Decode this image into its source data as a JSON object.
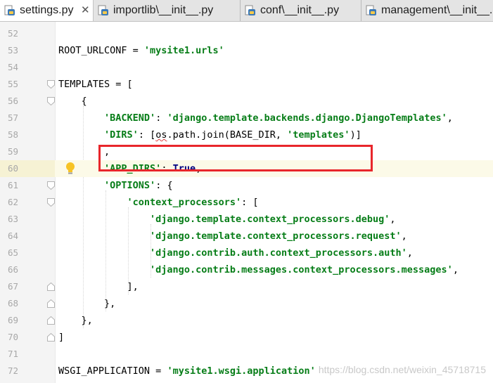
{
  "tabs": [
    {
      "label": "settings.py",
      "active": true,
      "close": "✕"
    },
    {
      "label": "importlib\\__init__.py",
      "active": false
    },
    {
      "label": "conf\\__init__.py",
      "active": false
    },
    {
      "label": "management\\__init__.py",
      "active": false
    }
  ],
  "lines": [
    {
      "no": "52",
      "code": ""
    },
    {
      "no": "53",
      "code": "ROOT_URLCONF = 'mysite1.urls'"
    },
    {
      "no": "54",
      "code": ""
    },
    {
      "no": "55",
      "code": "TEMPLATES = ["
    },
    {
      "no": "56",
      "code": "    {"
    },
    {
      "no": "57",
      "code": "        'BACKEND': 'django.template.backends.django.DjangoTemplates',"
    },
    {
      "no": "58",
      "code": "        'DIRS': [os.path.join(BASE_DIR, 'templates')]"
    },
    {
      "no": "59",
      "code": "        ,"
    },
    {
      "no": "60",
      "code": "        'APP_DIRS': True,"
    },
    {
      "no": "61",
      "code": "        'OPTIONS': {"
    },
    {
      "no": "62",
      "code": "            'context_processors': ["
    },
    {
      "no": "63",
      "code": "                'django.template.context_processors.debug',"
    },
    {
      "no": "64",
      "code": "                'django.template.context_processors.request',"
    },
    {
      "no": "65",
      "code": "                'django.contrib.auth.context_processors.auth',"
    },
    {
      "no": "66",
      "code": "                'django.contrib.messages.context_processors.messages',"
    },
    {
      "no": "67",
      "code": "            ],"
    },
    {
      "no": "68",
      "code": "        },"
    },
    {
      "no": "69",
      "code": "    },"
    },
    {
      "no": "70",
      "code": "]"
    },
    {
      "no": "71",
      "code": ""
    },
    {
      "no": "72",
      "code": "WSGI_APPLICATION = 'mysite1.wsgi.application'"
    }
  ],
  "current_line": "60",
  "watermark": "https://blog.csdn.net/weixin_45718715",
  "colors": {
    "string": "#067d17",
    "keyword": "#000080",
    "highlight_box": "#e8262b",
    "current_line": "#fcfae8"
  },
  "icons": {
    "tab_file": "python-file-icon",
    "gutter_hint": "lightbulb-icon",
    "fold": "fold-marker-icon"
  }
}
